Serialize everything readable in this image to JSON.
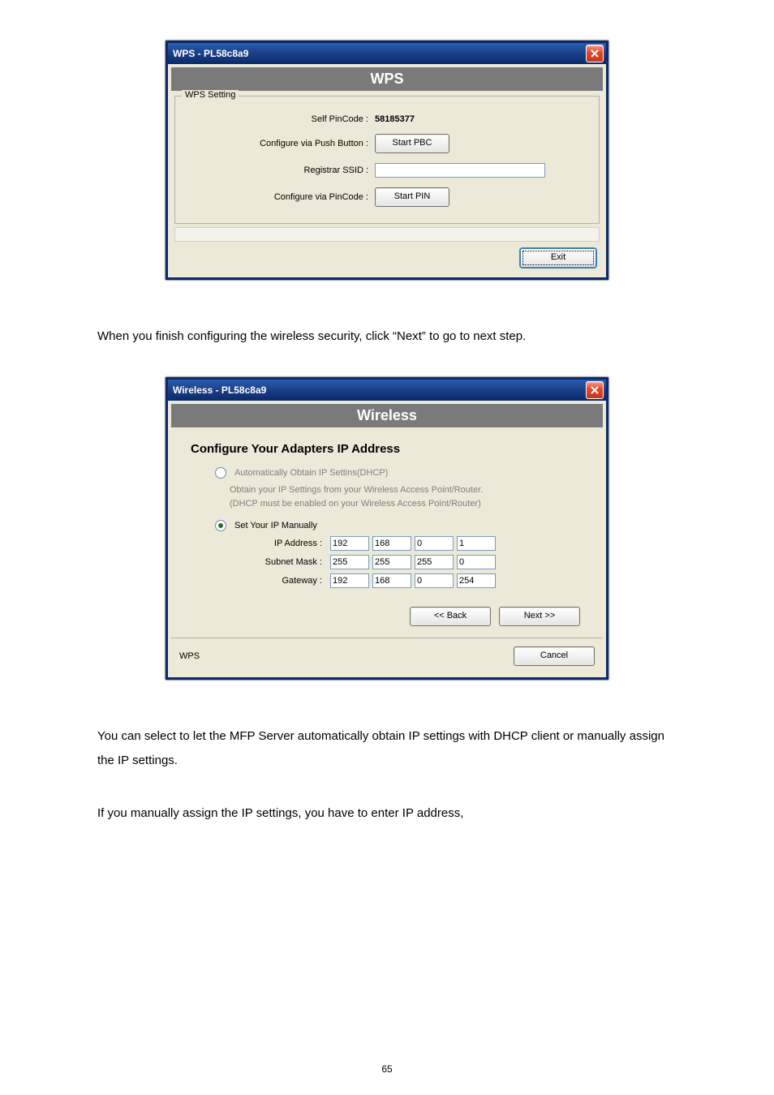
{
  "wps_dialog": {
    "title": "WPS - PL58c8a9",
    "section_title": "WPS",
    "group_title": "WPS Setting",
    "self_pincode_label": "Self PinCode :",
    "self_pincode_value": "58185377",
    "push_button_label": "Configure via Push Button :",
    "start_pbc_label": "Start PBC",
    "registrar_ssid_label": "Registrar SSID :",
    "registrar_ssid_value": "",
    "pin_label": "Configure via PinCode :",
    "start_pin_label": "Start PIN",
    "exit_label": "Exit"
  },
  "text1": "When you finish configuring the wireless security, click “Next” to go to next step.",
  "wireless_dialog": {
    "title": "Wireless - PL58c8a9",
    "section_title": "Wireless",
    "heading": "Configure Your Adapters IP Address",
    "auto_label": "Automatically Obtain IP Settins(DHCP)",
    "help1": "Obtain your IP Settings from your Wireless Access Point/Router.",
    "help2": "(DHCP must be enabled on your Wireless Access Point/Router)",
    "manual_label": "Set Your IP Manually",
    "ip_address_label": "IP Address :",
    "subnet_mask_label": "Subnet Mask :",
    "gateway_label": "Gateway :",
    "ip": {
      "a": "192",
      "b": "168",
      "c": "0",
      "d": "1"
    },
    "mask": {
      "a": "255",
      "b": "255",
      "c": "255",
      "d": "0"
    },
    "gw": {
      "a": "192",
      "b": "168",
      "c": "0",
      "d": "254"
    },
    "back_label": "<< Back",
    "next_label": "Next >>",
    "wps_label": "WPS",
    "cancel_label": "Cancel"
  },
  "text2": "You can select to let the MFP Server automatically obtain IP settings with DHCP client or manually assign the IP settings.",
  "text3": "If you manually assign the IP settings, you have to enter IP address,",
  "page_number": "65"
}
